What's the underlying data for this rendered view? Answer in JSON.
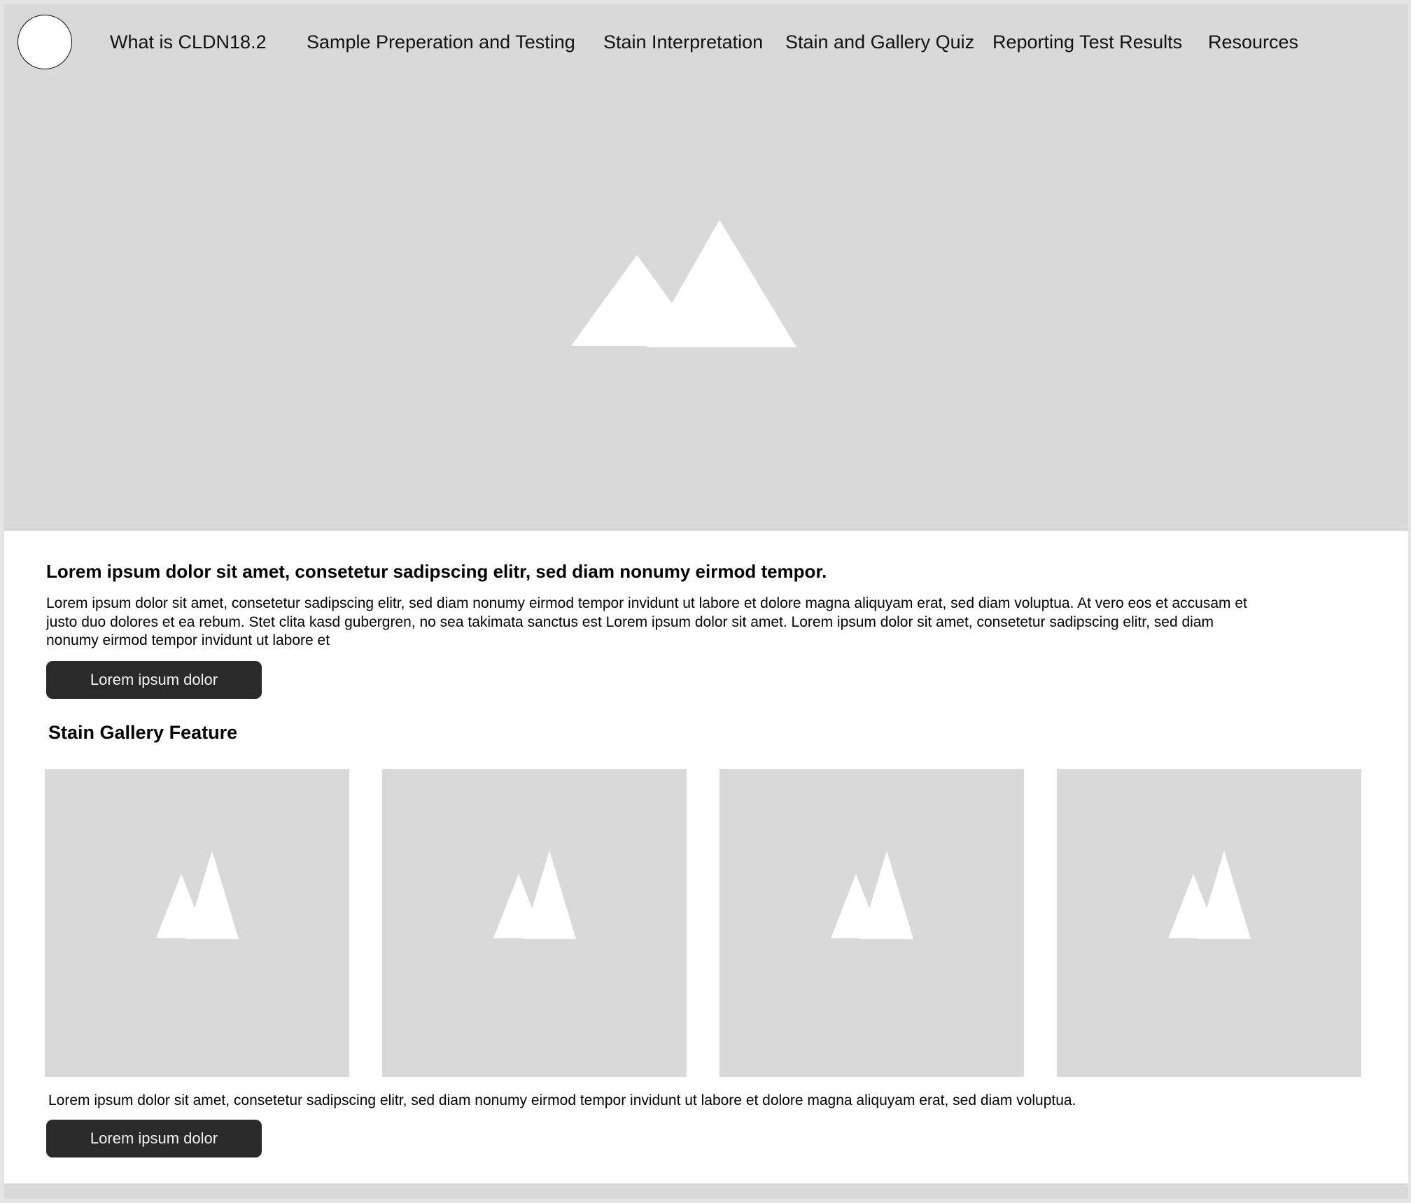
{
  "nav": {
    "items": [
      {
        "label": "What is CLDN18.2"
      },
      {
        "label": "Sample Preperation and Testing"
      },
      {
        "label": "Stain Interpretation"
      },
      {
        "label": "Stain and Gallery Quiz"
      },
      {
        "label": "Reporting Test Results"
      },
      {
        "label": "Resources"
      }
    ]
  },
  "hero": {
    "image_icon": "image-placeholder-icon"
  },
  "intro": {
    "heading": "Lorem ipsum dolor sit amet, consetetur sadipscing elitr, sed diam nonumy eirmod tempor.",
    "body": "Lorem ipsum dolor sit amet, consetetur sadipscing elitr, sed diam nonumy eirmod tempor invidunt ut labore et dolore magna aliquyam erat, sed diam voluptua. At vero eos et accusam et justo duo dolores et ea rebum. Stet clita kasd gubergren, no sea takimata sanctus est Lorem ipsum dolor sit amet. Lorem ipsum dolor sit amet, consetetur sadipscing elitr, sed diam nonumy eirmod tempor invidunt ut labore et",
    "button_label": "Lorem ipsum dolor"
  },
  "gallery": {
    "heading": "Stain Gallery Feature",
    "image_icon": "image-placeholder-icon",
    "caption": "Lorem ipsum dolor sit amet, consetetur sadipscing elitr, sed diam nonumy eirmod tempor invidunt ut labore et dolore magna aliquyam erat, sed diam voluptua.",
    "button_label": "Lorem ipsum dolor"
  },
  "colors": {
    "placeholder_gray": "#d9d9d9",
    "button_dark": "#2a2a2a",
    "button_text": "#f2f2f2",
    "content_bg": "#ffffff"
  }
}
